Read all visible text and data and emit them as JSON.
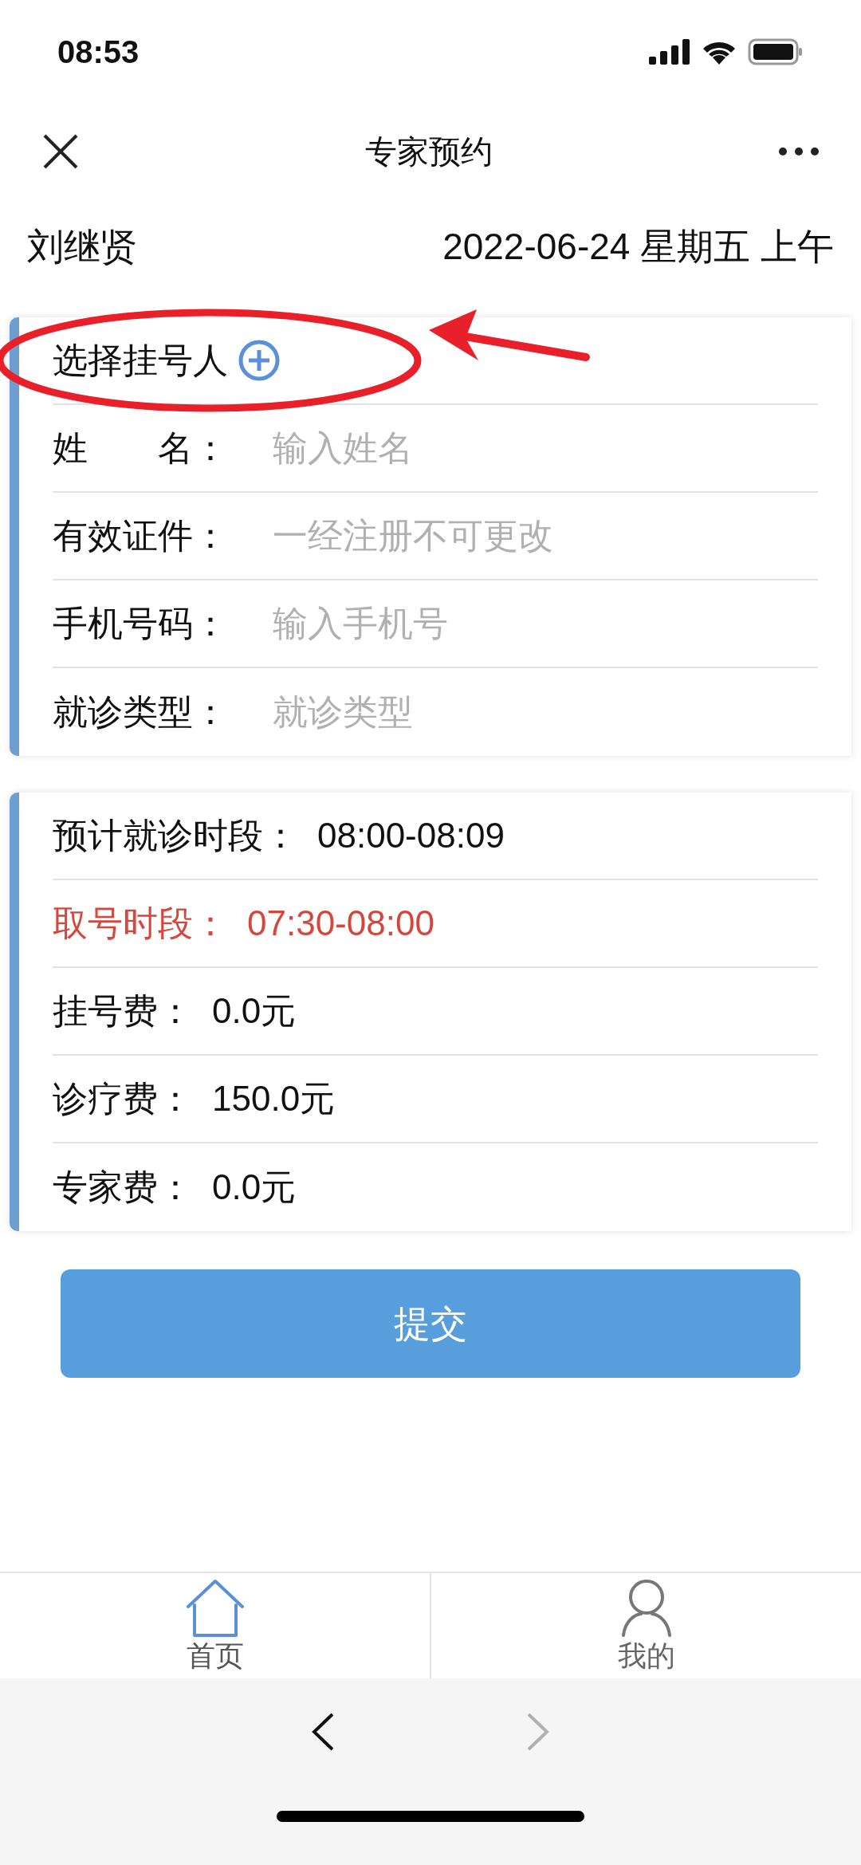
{
  "status_bar": {
    "time": "08:53"
  },
  "nav_bar": {
    "title": "专家预约"
  },
  "header": {
    "doctor": "刘继贤",
    "date": "2022-06-24 星期五 上午"
  },
  "patient_card": {
    "select_label": "选择挂号人",
    "fields": [
      {
        "label": "姓　　名：",
        "placeholder": "输入姓名"
      },
      {
        "label": "有效证件：",
        "placeholder": "一经注册不可更改"
      },
      {
        "label": "手机号码：",
        "placeholder": "输入手机号"
      },
      {
        "label": "就诊类型：",
        "placeholder": "就诊类型"
      }
    ]
  },
  "info_card": {
    "rows": [
      {
        "label": "预计就诊时段：",
        "value": "08:00-08:09",
        "highlight": false
      },
      {
        "label": "取号时段：",
        "value": "07:30-08:00",
        "highlight": true
      },
      {
        "label": "挂号费：",
        "value": "0.0元",
        "highlight": false
      },
      {
        "label": "诊疗费：",
        "value": "150.0元",
        "highlight": false
      },
      {
        "label": "专家费：",
        "value": "0.0元",
        "highlight": false
      }
    ]
  },
  "submit_button": "提交",
  "tab_bar": [
    {
      "label": "首页",
      "kind": "home",
      "selected": true
    },
    {
      "label": "我的",
      "kind": "profile",
      "selected": false
    }
  ],
  "browser_bar": {
    "back_enabled": true,
    "forward_enabled": false
  }
}
